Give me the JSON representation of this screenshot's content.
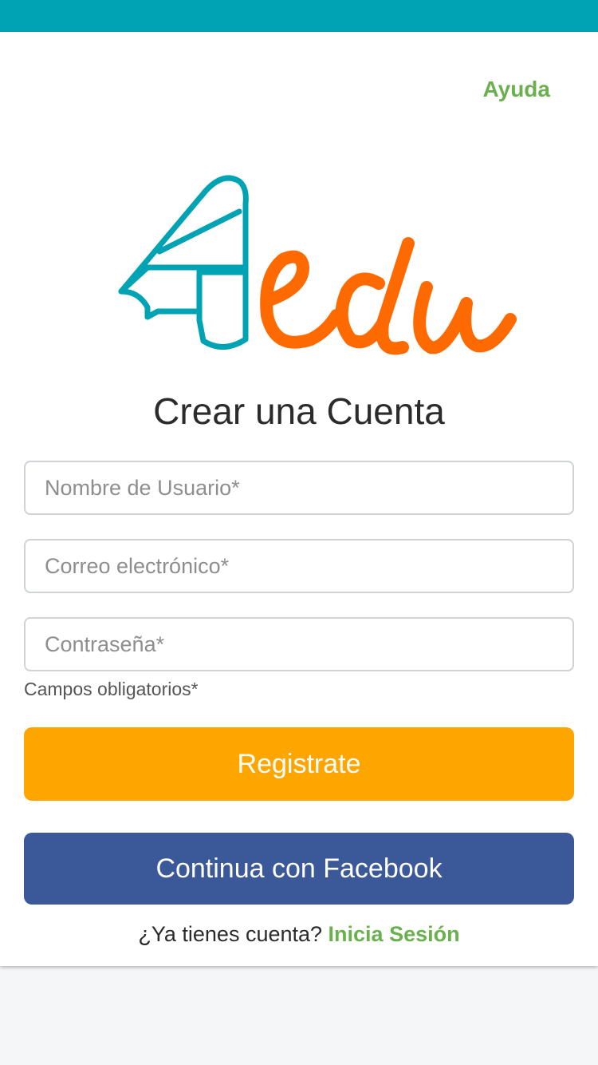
{
  "header": {
    "help_label": "Ayuda"
  },
  "brand": {
    "logo_text": "4edu",
    "accent_teal": "#00a3b3",
    "accent_orange": "#ff6a00"
  },
  "form": {
    "title": "Crear una Cuenta",
    "username_placeholder": "Nombre de Usuario*",
    "email_placeholder": "Correo electrónico*",
    "password_placeholder": "Contraseña*",
    "required_note": "Campos obligatorios*",
    "register_label": "Registrate",
    "facebook_label": "Continua con Facebook"
  },
  "footer": {
    "have_account_text": "¿Ya tienes cuenta?",
    "login_label": "Inicia Sesión"
  },
  "colors": {
    "register_button": "#ffa500",
    "facebook_button": "#3b5998",
    "link_green": "#6ab04c"
  }
}
